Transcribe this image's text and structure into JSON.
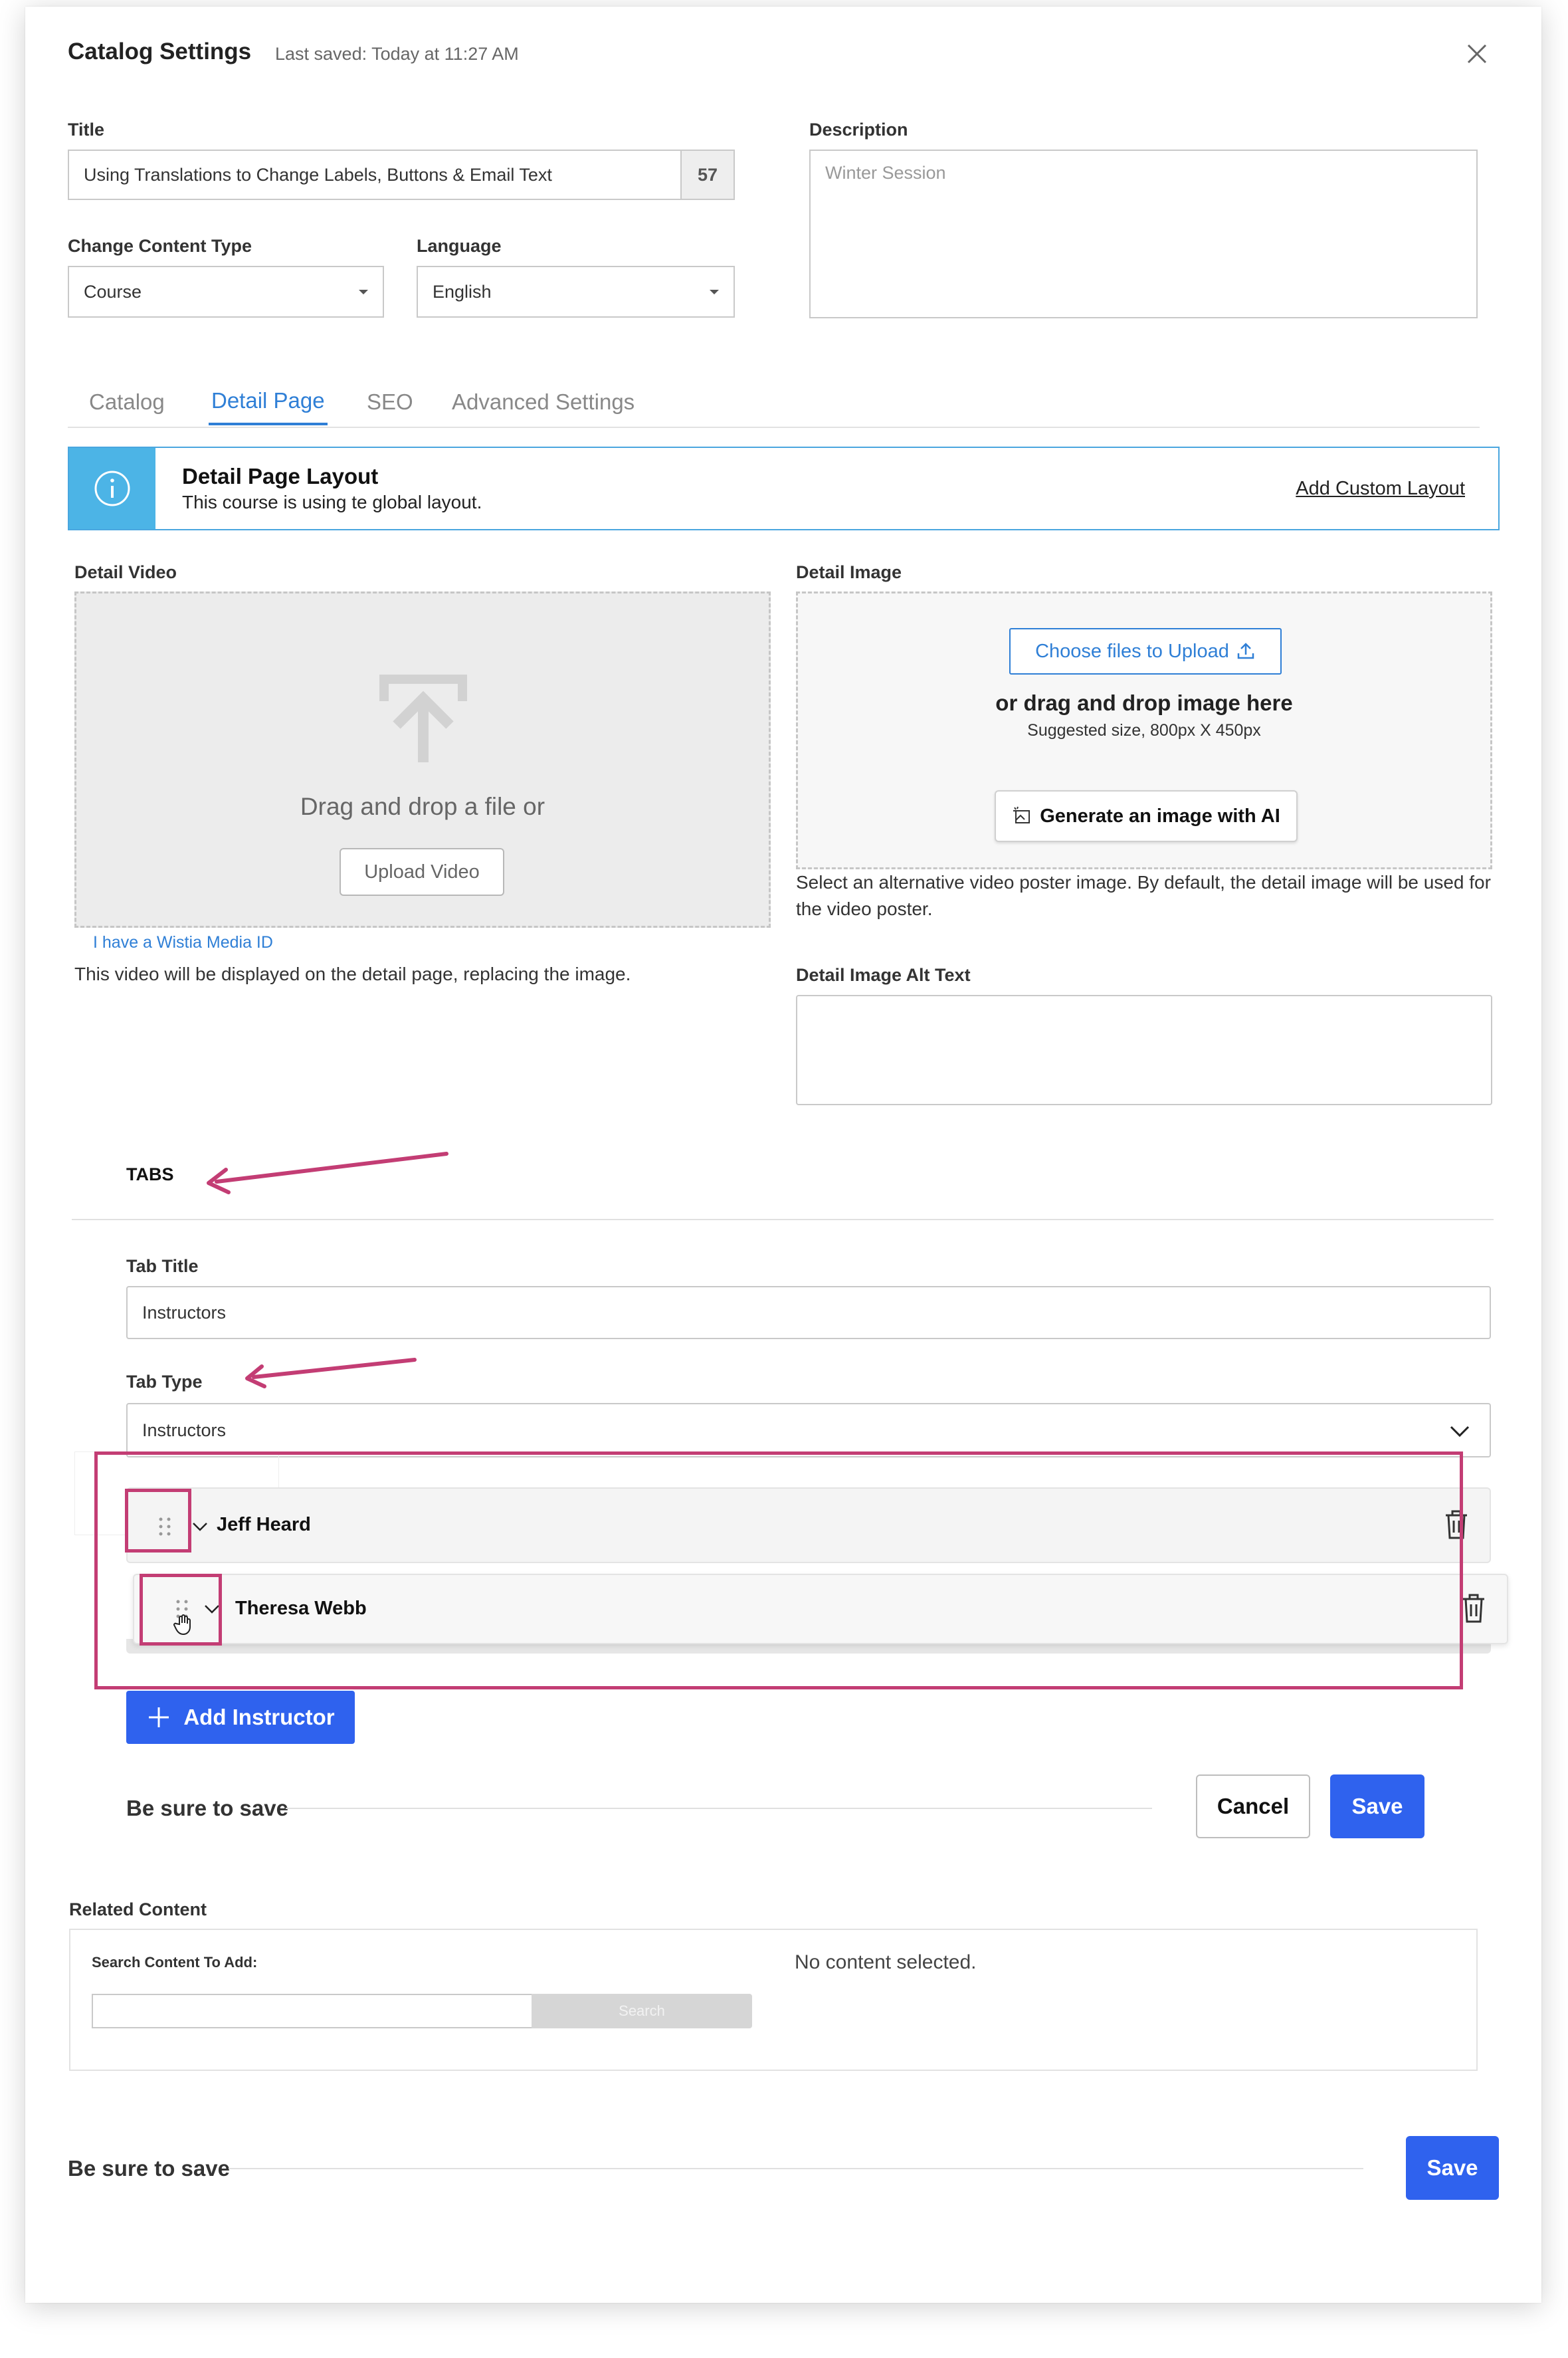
{
  "header": {
    "title": "Catalog Settings",
    "last_saved": "Last saved: Today at 11:27 AM"
  },
  "form": {
    "title_label": "Title",
    "title_value": "Using Translations to Change Labels, Buttons & Email Text",
    "title_counter": "57",
    "description_label": "Description",
    "description_placeholder": "Winter Session",
    "content_type_label": "Change Content Type",
    "content_type_value": "Course",
    "language_label": "Language",
    "language_value": "English"
  },
  "tabs": [
    {
      "label": "Catalog"
    },
    {
      "label": "Detail Page"
    },
    {
      "label": "SEO"
    },
    {
      "label": "Advanced Settings"
    }
  ],
  "banner": {
    "title": "Detail Page Layout",
    "subtitle": "This course is using te global layout.",
    "link": "Add Custom Layout"
  },
  "detail_video": {
    "label": "Detail Video",
    "drop_text": "Drag and drop a file or",
    "upload_button": "Upload Video",
    "wistia_link": "I have a Wistia Media ID",
    "help": "This video will be displayed on the detail page, replacing the image."
  },
  "detail_image": {
    "label": "Detail Image",
    "choose_button": "Choose files to Upload",
    "drag_text": "or drag and drop image here",
    "suggested": "Suggested size, 800px X 450px",
    "ai_button": "Generate an image with AI",
    "help": "Select an alternative video poster image. By default, the detail image will be used for the video poster.",
    "alt_label": "Detail Image Alt Text"
  },
  "tabs_section": {
    "heading": "TABS",
    "tab_title_label": "Tab Title",
    "tab_title_value": "Instructors",
    "tab_type_label": "Tab Type",
    "tab_type_value": "Instructors",
    "instructors": [
      {
        "name": "Jeff Heard"
      },
      {
        "name": "Theresa Webb"
      }
    ],
    "add_button": "Add Instructor",
    "be_sure": "Be sure to save",
    "cancel": "Cancel",
    "save": "Save"
  },
  "related": {
    "label": "Related Content",
    "search_label": "Search Content To Add:",
    "search_button": "Search",
    "empty": "No content selected."
  },
  "footer": {
    "be_sure": "Be sure to save",
    "save": "Save"
  },
  "colors": {
    "primary": "#2f62ee",
    "link": "#2f7fd6",
    "info": "#4cb4e6",
    "annotation": "#c33d74"
  }
}
